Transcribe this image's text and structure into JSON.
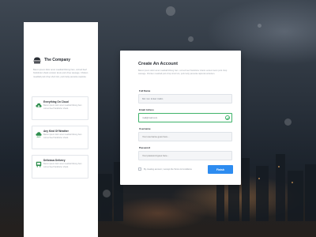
{
  "sidebar": {
    "brand_title": "The Company",
    "brand_desc": "Bacon ipsum dolor amet meatball biltong ham, corned beef frankfurter shank venison kevin pork chop sausage. Chicken meatball pork chop short loin, pork belly pancetta capicola.",
    "features": [
      {
        "title": "Everything On Cloud",
        "icon": "cloud-upload-icon",
        "desc": "Bacon ipsum dolor amet meatball biltong ham corned beef frankfurter shank."
      },
      {
        "title": "Any Kind Of Weather",
        "icon": "cloud-rain-icon",
        "desc": "Bacon ipsum dolor amet meatball biltong ham corned beef frankfurter shank."
      },
      {
        "title": "Delicious Delivery",
        "icon": "delivery-truck-icon",
        "desc": "Bacon ipsum dolor amet meatball biltong ham corned beef frankfurter shank."
      }
    ]
  },
  "form": {
    "title": "Create An Account",
    "desc": "Bacon ipsum dolor amet meatball biltong ham, corned beef frankfurter shank venison kevin pork chop sausage. Chicken meatball pork chop short loin, pork belly pancetta capicola turducken.",
    "fields": {
      "full_name": {
        "label": "Full Name",
        "value": "Md. Gm Imtiaz Uddin"
      },
      "email": {
        "label": "Email Adress",
        "value": "mail@mail.com"
      },
      "username": {
        "label": "Username",
        "placeholder": "Your username goes here..."
      },
      "password": {
        "label": "Password",
        "placeholder": "Your password goes here..."
      }
    },
    "agree_label": "By creating account, I accept the Terms & Conditions",
    "submit_label": "Finish"
  },
  "colors": {
    "accent": "#2d8cf0",
    "valid": "#3fb36a",
    "icon_green": "#2f8f4e"
  }
}
